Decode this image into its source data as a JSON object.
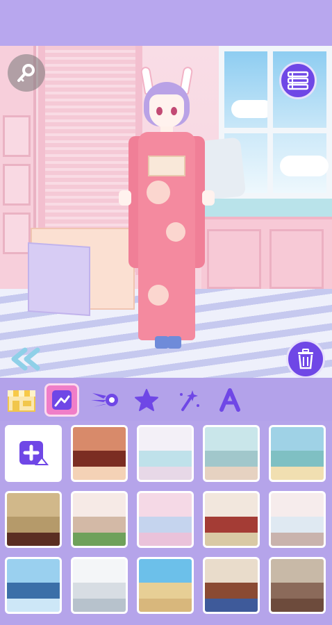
{
  "app": {
    "colors": {
      "topbar": "#b8a7ee",
      "accent": "#6f47e6",
      "tab_selected": "#f07ec8",
      "panel": "#b5a4ea"
    }
  },
  "scene": {
    "key_button_icon": "key-icon",
    "menu_button_icon": "list-menu-icon",
    "trash_button_icon": "trash-icon",
    "back_button_icon": "double-chevron-left-icon"
  },
  "tabs": [
    {
      "id": "shop",
      "icon": "storefront-icon",
      "selected": false
    },
    {
      "id": "backgrounds",
      "icon": "background-image-icon",
      "selected": true
    },
    {
      "id": "wings",
      "icon": "wing-icon",
      "selected": false
    },
    {
      "id": "stickers",
      "icon": "star-icon",
      "selected": false
    },
    {
      "id": "effects",
      "icon": "magic-wand-icon",
      "selected": false
    },
    {
      "id": "text",
      "icon": "letter-a-icon",
      "selected": false
    }
  ],
  "backgrounds": {
    "add_icon": "add-image-icon",
    "items": [
      {
        "name": "bg-living-room-dresser",
        "palette": [
          "#d88a6a",
          "#7b2d22",
          "#f4d2b6"
        ]
      },
      {
        "name": "bg-pastel-shopfront",
        "palette": [
          "#f3f0f7",
          "#bfe1ea",
          "#e7d8e7"
        ]
      },
      {
        "name": "bg-teal-storefront",
        "palette": [
          "#c9e6ea",
          "#a1c7cb",
          "#e6d2c1"
        ]
      },
      {
        "name": "bg-beach",
        "palette": [
          "#9fd2e6",
          "#7fc0c3",
          "#f1dfb1"
        ]
      },
      {
        "name": "bg-damask-wall",
        "palette": [
          "#d1b88a",
          "#b59a6a",
          "#5a2e22"
        ]
      },
      {
        "name": "bg-plant-window-room",
        "palette": [
          "#f6eae6",
          "#d3b9a6",
          "#6fa15b"
        ]
      },
      {
        "name": "bg-pink-classroom",
        "palette": [
          "#f5d9e6",
          "#c5d4ee",
          "#eac2da"
        ]
      },
      {
        "name": "bg-round-window-crest",
        "palette": [
          "#f2e7dd",
          "#a43c35",
          "#d9c9a5"
        ]
      },
      {
        "name": "bg-balcony-city",
        "palette": [
          "#f6ecec",
          "#dfe9f2",
          "#c9b3ad"
        ]
      },
      {
        "name": "bg-city-skyline",
        "palette": [
          "#9ad0ef",
          "#3b6fa8",
          "#cde7f7"
        ]
      },
      {
        "name": "bg-white-hallway",
        "palette": [
          "#f4f6f8",
          "#d7dde3",
          "#b7c2cc"
        ]
      },
      {
        "name": "bg-desert",
        "palette": [
          "#6cc0ea",
          "#e7cf95",
          "#d8b77c"
        ]
      },
      {
        "name": "bg-checker-floor-door",
        "palette": [
          "#e9dccb",
          "#8a4a33",
          "#3e5a9a"
        ]
      },
      {
        "name": "bg-wooden-room",
        "palette": [
          "#c8b9a7",
          "#8b6a5a",
          "#6d4b3c"
        ]
      }
    ]
  }
}
